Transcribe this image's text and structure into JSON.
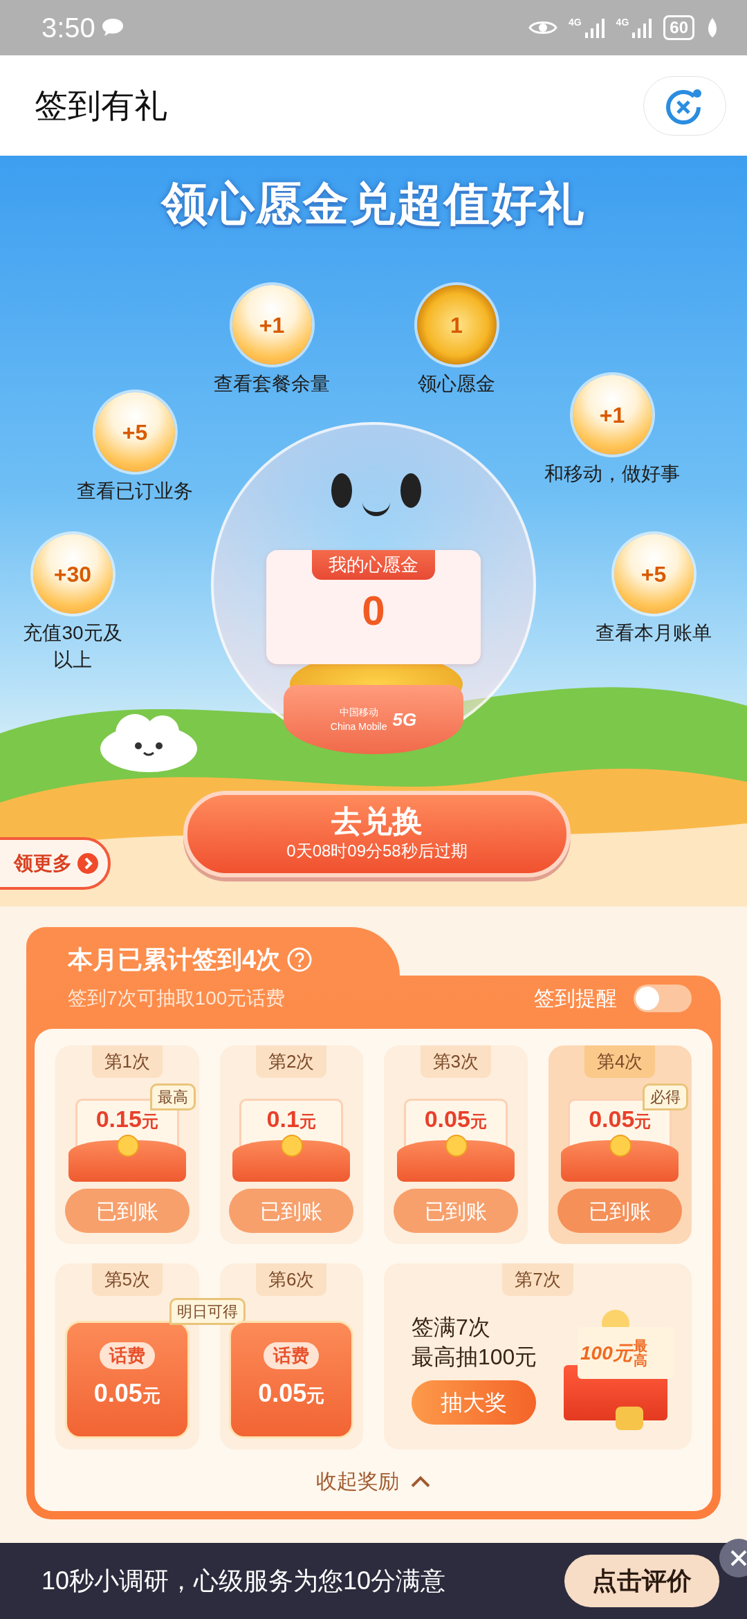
{
  "status_bar": {
    "time": "3:50",
    "network": [
      "4G",
      "4G"
    ],
    "battery": "60"
  },
  "header": {
    "title": "签到有礼"
  },
  "hero": {
    "title": "领心愿金兑超值好礼",
    "tasks": [
      {
        "reward": "+1",
        "label": "查看套餐余量",
        "kind": "bubble"
      },
      {
        "reward": "1",
        "label": "领心愿金",
        "kind": "coin"
      },
      {
        "reward": "+5",
        "label": "查看已订业务",
        "kind": "bubble"
      },
      {
        "reward": "+1",
        "label": "和移动，做好事",
        "kind": "bubble"
      },
      {
        "reward": "+30",
        "label": "充值30元及以上",
        "kind": "bubble"
      },
      {
        "reward": "+5",
        "label": "查看本月账单",
        "kind": "bubble"
      }
    ],
    "wish_card": {
      "label": "我的心愿金",
      "amount": "0"
    },
    "globe_base": {
      "brand": "中国移动",
      "brand_en": "China Mobile",
      "network": "5G"
    },
    "exchange_button": {
      "label": "去兑换",
      "countdown": "0天08时09分58秒后过期"
    },
    "more_tab": "领更多"
  },
  "checkin": {
    "title": "本月已累计签到4次",
    "subtitle": "签到7次可抽取100元话费",
    "reminder": {
      "label": "签到提醒",
      "on": false
    },
    "days": [
      {
        "label": "第1次",
        "kind": "claimed",
        "amount": "0.15",
        "unit": "元",
        "tag": "最高",
        "status": "已到账",
        "selected": false
      },
      {
        "label": "第2次",
        "kind": "claimed",
        "amount": "0.1",
        "unit": "元",
        "status": "已到账",
        "selected": false
      },
      {
        "label": "第3次",
        "kind": "claimed",
        "amount": "0.05",
        "unit": "元",
        "status": "已到账",
        "selected": false
      },
      {
        "label": "第4次",
        "kind": "claimed",
        "amount": "0.05",
        "unit": "元",
        "tag": "必得",
        "status": "已到账",
        "selected": true
      },
      {
        "label": "第5次",
        "kind": "upcoming",
        "category": "话费",
        "amount": "0.05",
        "unit": "元",
        "tag": "明日可得",
        "selected": false
      },
      {
        "label": "第6次",
        "kind": "upcoming",
        "category": "话费",
        "amount": "0.05",
        "unit": "元",
        "selected": false
      },
      {
        "label": "第7次",
        "kind": "grand",
        "lines": [
          "签满7次",
          "最高抽100元"
        ],
        "button": "抽大奖",
        "prize": "100元",
        "prize_tag": "最高",
        "selected": false
      }
    ],
    "collapse": "收起奖励"
  },
  "survey_banner": {
    "text": "10秒小调研，心级服务为您10分满意",
    "button": "点击评价"
  }
}
